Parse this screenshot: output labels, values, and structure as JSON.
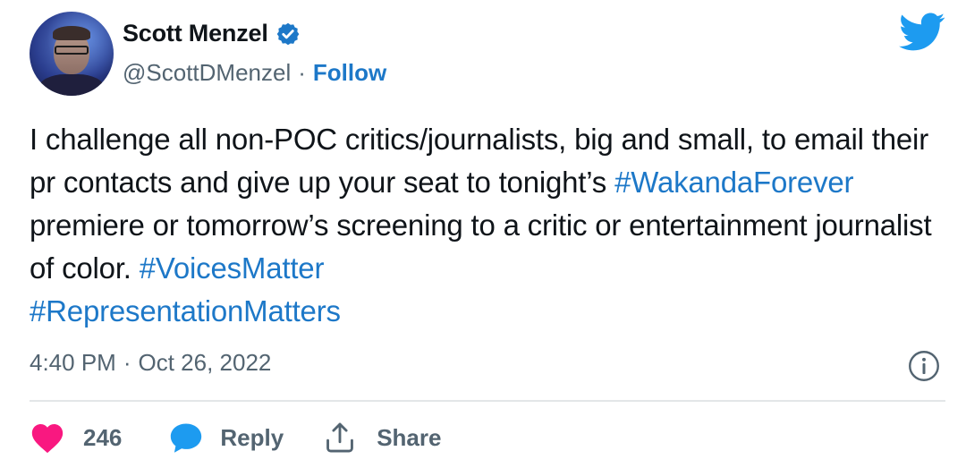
{
  "user": {
    "display_name": "Scott Menzel",
    "handle": "@ScottDMenzel",
    "separator": "·",
    "follow_label": "Follow",
    "verified": true
  },
  "tweet": {
    "segments": [
      {
        "text": "I challenge all non-POC critics/journalists, big and small, to email their pr contacts and give up your  seat to tonight’s ",
        "type": "text"
      },
      {
        "text": "#WakandaForever",
        "type": "hashtag"
      },
      {
        "text": " premiere or tomorrow’s screening to a critic or entertainment journalist of color. ",
        "type": "text"
      },
      {
        "text": "#VoicesMatter",
        "type": "hashtag"
      },
      {
        "text": " ",
        "type": "text"
      },
      {
        "text": "#RepresentationMatters",
        "type": "hashtag"
      }
    ]
  },
  "meta": {
    "time": "4:40 PM",
    "separator": "·",
    "date": "Oct 26, 2022"
  },
  "actions": {
    "like_count": "246",
    "reply_label": "Reply",
    "share_label": "Share"
  },
  "colors": {
    "link": "#1d78c8",
    "like": "#f91880",
    "reply": "#1d9bf0",
    "twitter_brand": "#1d9bf0",
    "muted": "#536471"
  },
  "icons": {
    "brand": "twitter-bird-icon",
    "verified": "verified-badge-icon",
    "info": "info-icon",
    "like": "heart-icon",
    "reply": "speech-bubble-icon",
    "share": "share-upload-icon"
  }
}
